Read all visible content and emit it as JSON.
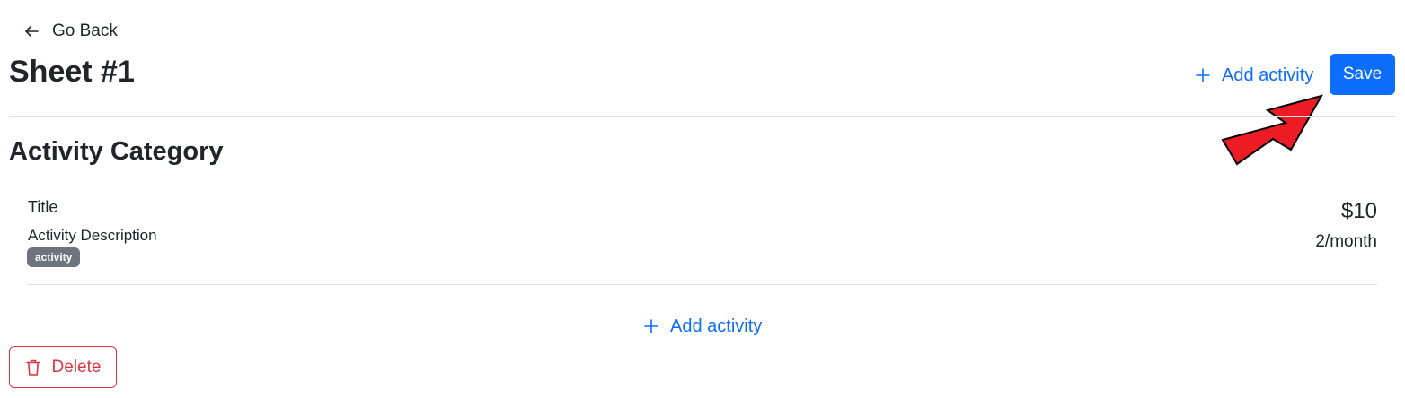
{
  "nav": {
    "back_label": "Go Back",
    "back_icon": "arrow-left-icon"
  },
  "sheet": {
    "title": "Sheet #1"
  },
  "toolbar": {
    "add_activity_label": "Add activity",
    "save_label": "Save"
  },
  "category": {
    "title": "Activity Category",
    "activities": [
      {
        "title": "Title",
        "description": "Activity Description",
        "badge": "activity",
        "price": "$10",
        "frequency": "2/month"
      }
    ],
    "add_activity_label": "Add activity"
  },
  "actions": {
    "delete_label": "Delete"
  },
  "colors": {
    "primary": "#0d6efd",
    "danger": "#dc3545",
    "badge": "#6c757d",
    "annotation_arrow": "#ed1c24"
  },
  "icons": {
    "back": "arrow-left-icon",
    "add": "plus-icon",
    "delete": "trash-icon",
    "annotation": "red-pointer-arrow"
  }
}
